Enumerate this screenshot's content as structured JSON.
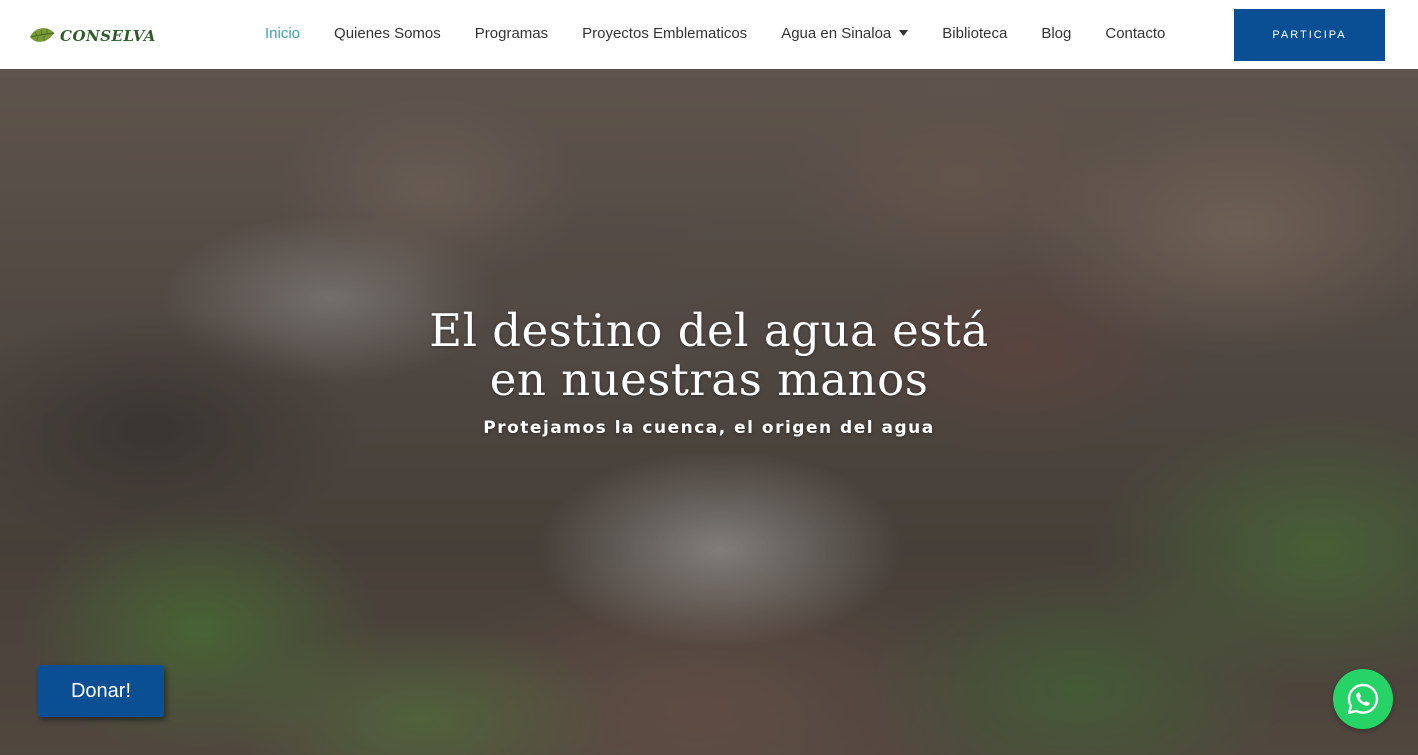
{
  "brand": {
    "logo_text": "CONSELVA",
    "logo_color": "#2e5c2a"
  },
  "nav": {
    "items": [
      {
        "label": "Inicio",
        "active": true
      },
      {
        "label": "Quienes Somos"
      },
      {
        "label": "Programas"
      },
      {
        "label": "Proyectos Emblematicos"
      },
      {
        "label": "Agua en Sinaloa",
        "has_dropdown": true
      },
      {
        "label": "Biblioteca"
      },
      {
        "label": "Blog"
      },
      {
        "label": "Contacto"
      }
    ],
    "active_color": "#3ba3b0",
    "cta_label": "PARTICIPA"
  },
  "hero": {
    "title_line1": "El destino del agua está",
    "title_line2": "en nuestras manos",
    "subtitle": "Protejamos la cuenca, el origen del agua"
  },
  "donate_label": "Donar!",
  "colors": {
    "primary": "#0a4f93",
    "whatsapp": "#25d366"
  },
  "icons": {
    "logo": "leaf-icon",
    "dropdown": "chevron-down-icon",
    "chat": "whatsapp-icon"
  }
}
